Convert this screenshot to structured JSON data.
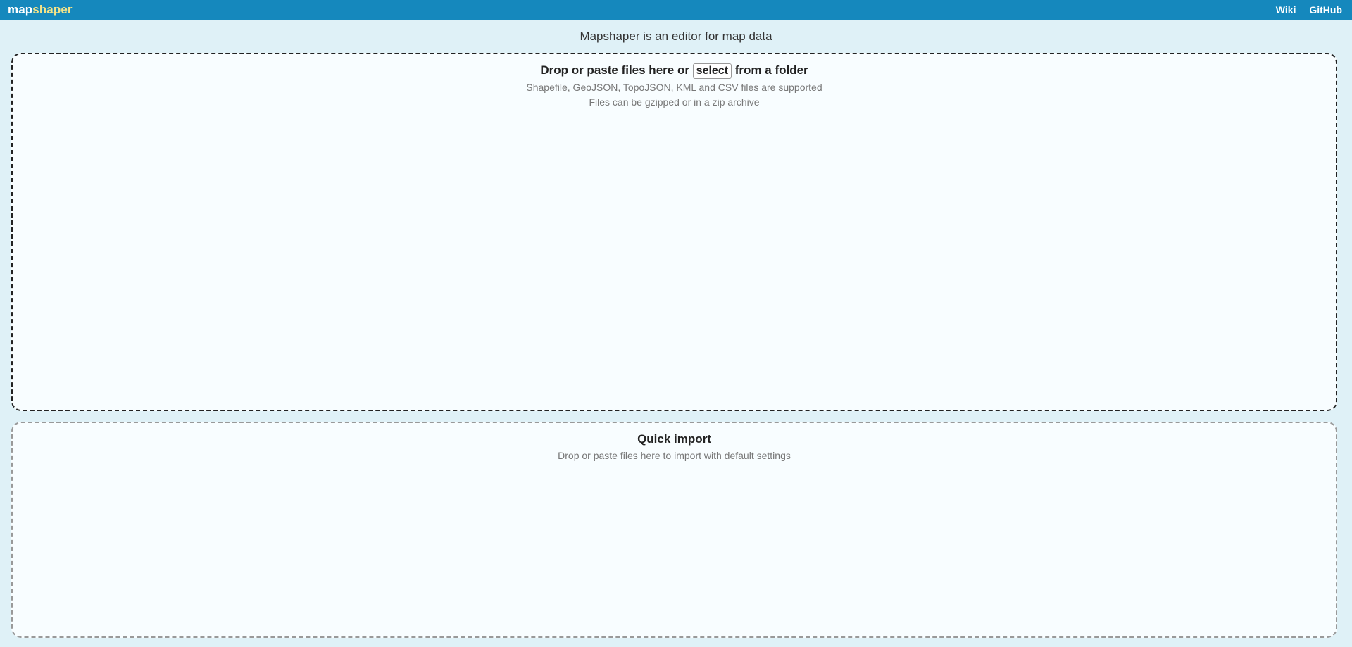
{
  "header": {
    "logo_part1": "map",
    "logo_part2": "shaper",
    "links": [
      {
        "label": "Wiki"
      },
      {
        "label": "GitHub"
      }
    ]
  },
  "intro": {
    "text": "Mapshaper is an editor for map data"
  },
  "drop_zone": {
    "text_before": "Drop or paste files here or ",
    "select_label": "select",
    "text_after": " from a folder",
    "note1": "Shapefile, GeoJSON, TopoJSON, KML and CSV files are supported",
    "note2": "Files can be gzipped or in a zip archive"
  },
  "quick_import": {
    "title": "Quick import",
    "note": "Drop or paste files here to import with default settings"
  },
  "colors": {
    "header_bg": "#1588bd",
    "page_bg": "#dff1f7",
    "logo_accent": "#f5e488"
  }
}
